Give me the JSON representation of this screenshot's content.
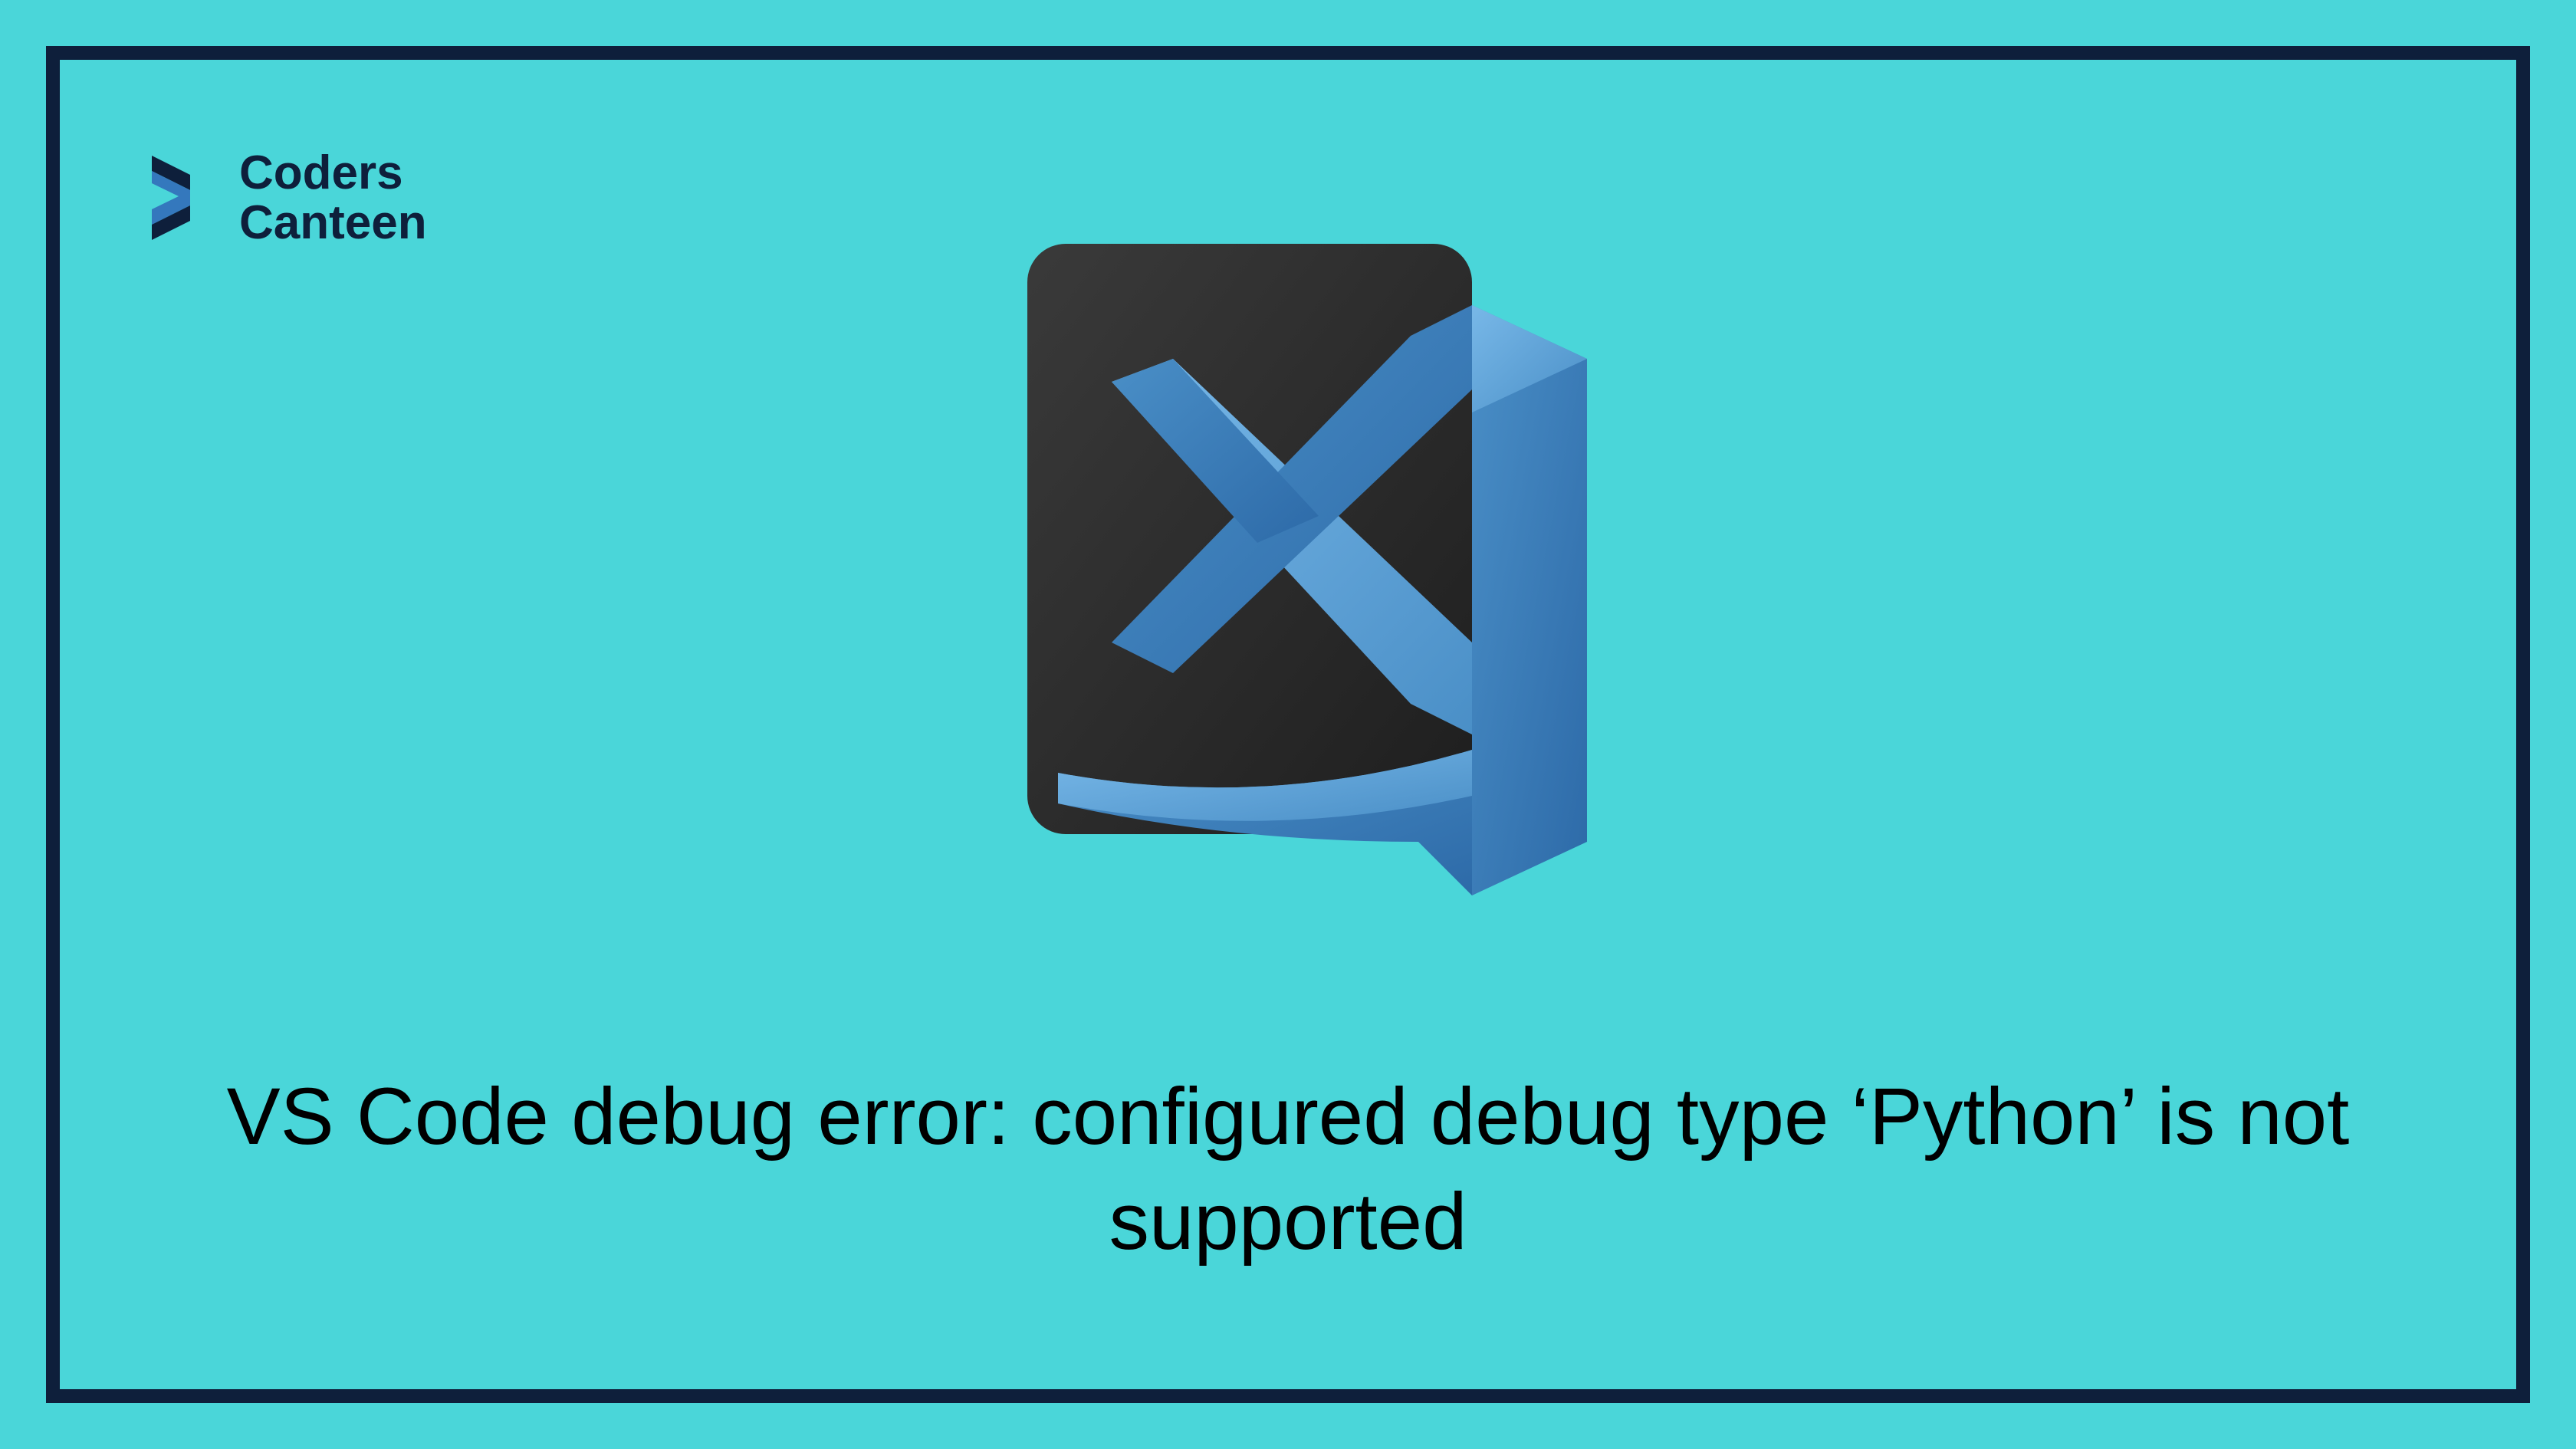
{
  "logo": {
    "line1": "Coders",
    "line2": "Canteen"
  },
  "title": "VS Code debug error: configured debug type ‘Python’ is not supported",
  "colors": {
    "background": "#4ad6d9",
    "border": "#0e1f3b",
    "vscode_blue_light": "#5a9fd4",
    "vscode_blue_dark": "#3478bd",
    "vscode_plate": "#2e2e2e"
  }
}
